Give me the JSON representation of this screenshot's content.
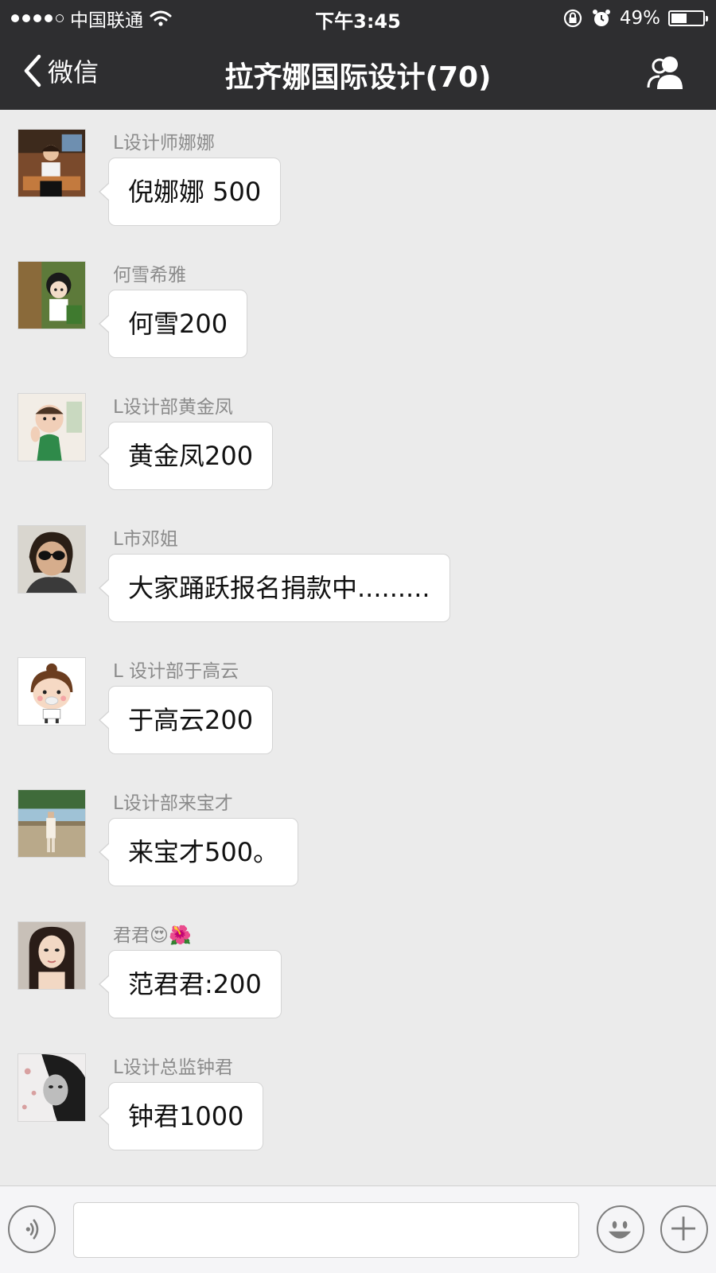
{
  "status_bar": {
    "carrier": "中国联通",
    "time": "下午3:45",
    "battery_percent": "49%",
    "battery_level": 0.49
  },
  "nav": {
    "back_label": "微信",
    "title": "拉齐娜国际设计(70)",
    "right_icon": "group-members-icon"
  },
  "messages": [
    {
      "sender": "L设计师娜娜",
      "text": "倪娜娜 500",
      "avatar_icon": "photo-woman-icon"
    },
    {
      "sender": "何雪希雅",
      "text": "何雪200",
      "avatar_icon": "cartoon-girl-icon"
    },
    {
      "sender": "L设计部黄金凤",
      "text": "黄金凤200",
      "avatar_icon": "baby-photo-icon"
    },
    {
      "sender": "L市邓姐",
      "text": "大家踊跃报名捐款中.........",
      "avatar_icon": "sunglasses-woman-icon"
    },
    {
      "sender": "L 设计部于高云",
      "text": "于高云200",
      "avatar_icon": "cartoon-avatar-icon"
    },
    {
      "sender": "L设计部来宝才",
      "text": "来宝才500。",
      "avatar_icon": "lakeside-photo-icon"
    },
    {
      "sender": "君君😍🌺",
      "text": "范君君:200",
      "avatar_icon": "selfie-woman-icon"
    },
    {
      "sender": "L设计总监钟君",
      "text": "钟君1000",
      "avatar_icon": "bw-portrait-icon"
    }
  ],
  "input_bar": {
    "voice_icon": "voice-icon",
    "text_value": "",
    "emoji_icon": "emoji-icon",
    "add_icon": "plus-icon"
  },
  "colors": {
    "topbar": "#2e2e30",
    "chat_background": "#ebebeb",
    "bubble": "#ffffff",
    "sender_text": "#8b8b8b"
  }
}
